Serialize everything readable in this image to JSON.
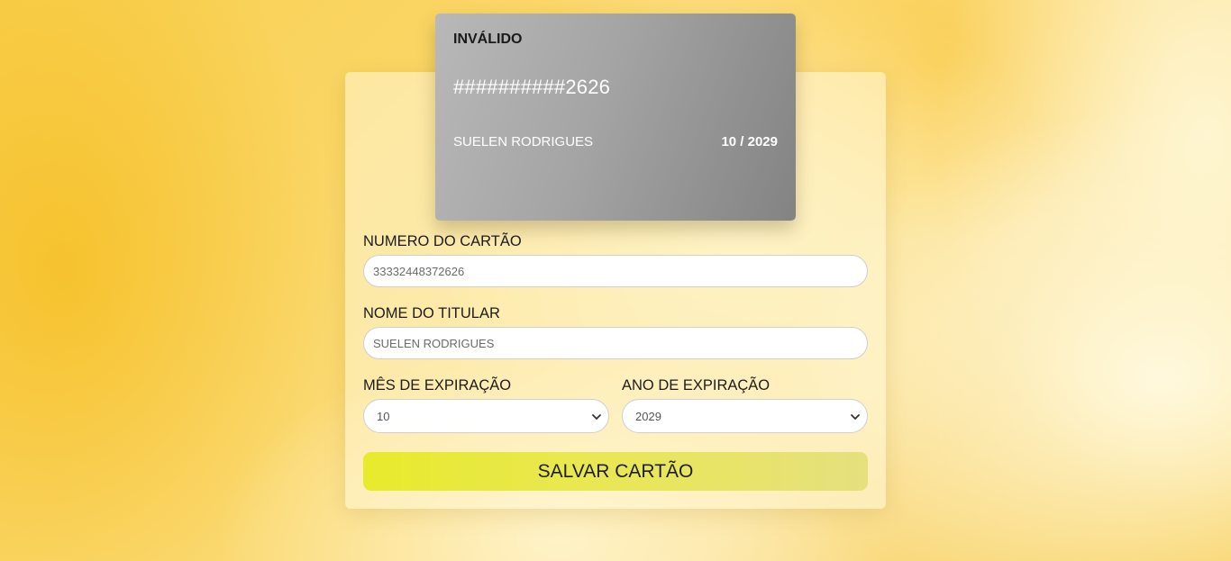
{
  "card": {
    "status": "INVÁLIDO",
    "number": "##########2626",
    "holder": "SUELEN RODRIGUES",
    "expiry": "10 / 2029"
  },
  "form": {
    "card_number": {
      "label": "NUMERO DO CARTÃO",
      "value": "33332448372626"
    },
    "holder_name": {
      "label": "NOME DO TITULAR",
      "value": "SUELEN RODRIGUES"
    },
    "exp_month": {
      "label": "MÊS DE EXPIRAÇÃO",
      "selected": "10"
    },
    "exp_year": {
      "label": "ANO DE EXPIRAÇÃO",
      "selected": "2029"
    },
    "save_label": "SALVAR CARTÃO"
  },
  "icons": {
    "select_arrow": "chevron-down-icon"
  },
  "colors": {
    "card_gradient_start": "#b9b8b8",
    "card_gradient_end": "#838383",
    "button_start": "#e8ea2c",
    "button_end": "#e6e07e"
  }
}
